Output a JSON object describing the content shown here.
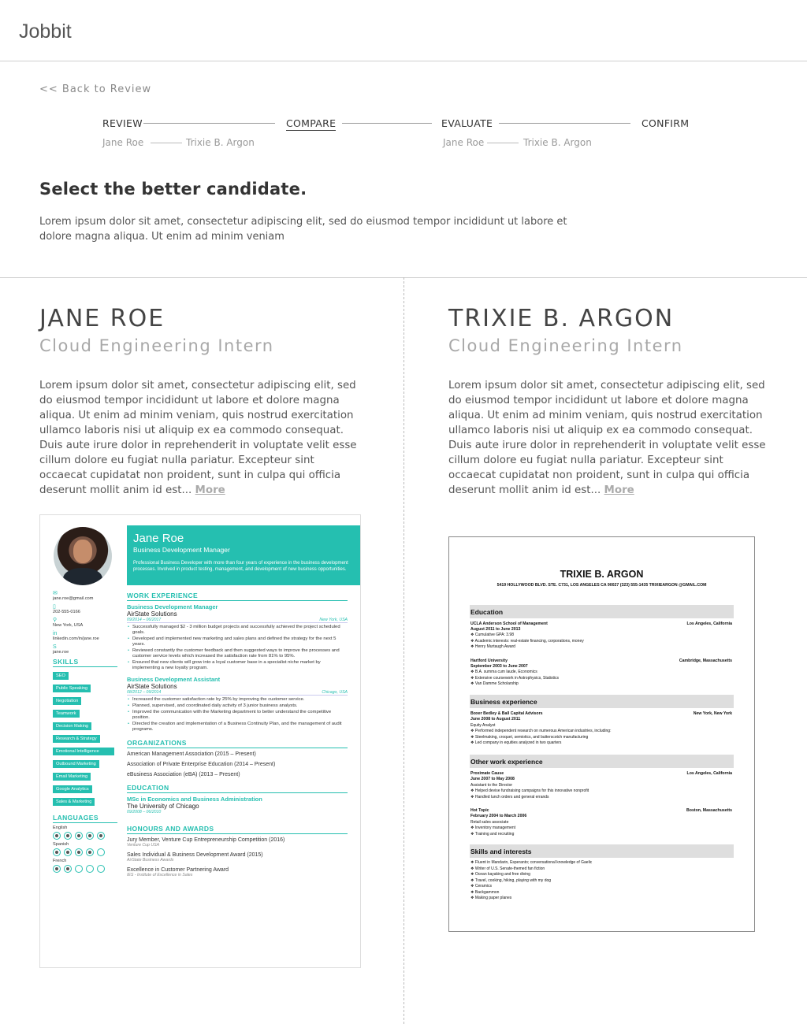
{
  "app": {
    "title": "Jobbit"
  },
  "nav": {
    "back": "<< Back to Review"
  },
  "steps": [
    {
      "label": "REVIEW",
      "names": [
        "Jane Roe",
        "Trixie B. Argon"
      ]
    },
    {
      "label": "COMPARE"
    },
    {
      "label": "EVALUATE",
      "names": [
        "Jane Roe",
        "Trixie B. Argon"
      ]
    },
    {
      "label": "CONFIRM"
    }
  ],
  "heading": "Select the better candidate.",
  "intro": "Lorem ipsum dolor sit amet, consectetur adipiscing elit, sed do eiusmod tempor incididunt ut labore et dolore magna aliqua. Ut enim ad minim veniam",
  "candidates": [
    {
      "name": "JANE ROE",
      "role": "Cloud Engineering Intern",
      "desc": "Lorem ipsum dolor sit amet, consectetur adipiscing elit, sed do eiusmod tempor incididunt ut labore et dolore magna aliqua. Ut enim ad minim veniam, quis nostrud exercitation ullamco laboris nisi ut aliquip ex ea commodo consequat. Duis aute irure dolor in reprehenderit in voluptate velit esse cillum dolore eu fugiat nulla pariatur. Excepteur sint occaecat cupidatat non proident, sunt in culpa qui officia deserunt mollit anim id est...",
      "more": "More"
    },
    {
      "name": "TRIXIE B. ARGON",
      "role": "Cloud Engineering Intern",
      "desc": "Lorem ipsum dolor sit amet, consectetur adipiscing elit, sed do eiusmod tempor incididunt ut labore et dolore magna aliqua. Ut enim ad minim veniam, quis nostrud exercitation ullamco laboris nisi ut aliquip ex ea commodo consequat. Duis aute irure dolor in reprehenderit in voluptate velit esse cillum dolore eu fugiat nulla pariatur. Excepteur sint occaecat cupidatat non proident, sunt in culpa qui officia deserunt mollit anim id est...",
      "more": "More"
    }
  ],
  "resume1": {
    "name": "Jane Roe",
    "title": "Business Development Manager",
    "summary": "Professional Business Developer with more than four years of experience in the business development processes. Involved in product testing, management, and development of new business opportunities.",
    "contact": [
      "jane.roe@gmail.com",
      "202-555-0166",
      "New York, USA",
      "linkedin.com/in/jane.roe",
      "jane.roe"
    ],
    "skills_heading": "SKILLS",
    "skills": [
      "SEO",
      "Public Speaking",
      "Negotiation",
      "Teamwork",
      "Decision Making",
      "Research & Strategy",
      "Emotional Intelligence",
      "Outbound Marketing",
      "Email Marketing",
      "Google Analytics",
      "Sales & Marketing"
    ],
    "languages_heading": "LANGUAGES",
    "languages": [
      {
        "name": "English",
        "level": 5
      },
      {
        "name": "Spanish",
        "level": 4
      },
      {
        "name": "French",
        "level": 2
      }
    ],
    "work_heading": "WORK EXPERIENCE",
    "jobs": [
      {
        "title": "Business Development Manager",
        "company": "AirState Solutions",
        "dates": "09/2014 – 06/2017",
        "place": "New York, USA",
        "bullets": [
          "Successfully managed $2 - 3 million budget projects and successfully achieved the project scheduled goals.",
          "Developed and implemented new marketing and sales plans and defined the strategy for the next 5 years.",
          "Reviewed constantly the customer feedback and then suggested ways to improve the processes and customer service levels which increased the satisfaction rate from 81% to 95%.",
          "Ensured that new clients will grow into a loyal customer base in a specialist niche market by implementing a new loyalty program."
        ]
      },
      {
        "title": "Business Development Assistant",
        "company": "AirState Solutions",
        "dates": "08/2012 – 09/2014",
        "place": "Chicago, USA",
        "bullets": [
          "Increased the customer satisfaction rate by 25% by improving the customer service.",
          "Planned, supervised, and coordinated daily activity of 3 junior business analysts.",
          "Improved the communication with the Marketing department to better understand the competitive position.",
          "Directed the creation and implementation of a Business Continuity Plan, and the management of audit programs."
        ]
      }
    ],
    "org_heading": "ORGANIZATIONS",
    "orgs": [
      "American Management Association (2015 – Present)",
      "Association of Private Enterprise Education (2014 – Present)",
      "eBusiness Association (eBA) (2013 – Present)"
    ],
    "edu_heading": "EDUCATION",
    "edu": {
      "degree": "MSc in Economics and Business Administration",
      "school": "The University of Chicago",
      "dates": "09/2008 – 06/2010"
    },
    "awards_heading": "HONOURS AND AWARDS",
    "awards": [
      {
        "name": "Jury Member, Venture Cup Entrepreneurship Competition (2016)",
        "org": "Venture Cup USA"
      },
      {
        "name": "Sales Individual & Business Development Award (2015)",
        "org": "AirState Business Awards"
      },
      {
        "name": "Excellence in Customer Partnering Award",
        "org": "IES - Institute of Excellence in Sales"
      }
    ]
  },
  "resume2": {
    "name": "TRIXIE B. ARGON",
    "address": "5419 HOLLYWOOD BLVD. STE. C731, LOS ANGELES CA 90027   (323) 555-1435   TRIXIEARGON @GMAIL.COM",
    "sections": {
      "education": "Education",
      "business": "Business experience",
      "other": "Other work experience",
      "skills": "Skills and interests"
    },
    "edu1": {
      "school": "UCLA Anderson School of Management",
      "place": "Los Angeles, California",
      "dates": "August 2011 to June 2013",
      "bullets": [
        "Cumulative GPA: 3.98",
        "Academic interests: real-estate financing, corporations, money",
        "Henry Murtaugh Award"
      ]
    },
    "edu2": {
      "school": "Hartford University",
      "place": "Cambridge, Massachusetts",
      "dates": "September 2003 to June 2007",
      "bullets": [
        "B.A. summa cum laude, Economics",
        "Extensive coursework in Astrophysics, Statistics",
        "Van Damme Scholarship"
      ]
    },
    "biz1": {
      "company": "Boxer Bedley & Ball Capital Advisors",
      "place": "New York, New York",
      "dates": "June 2008 to August 2011",
      "role": "Equity Analyst",
      "bullets": [
        "Performed independent research on numerous American industries, including:",
        "Steelmaking, croquet, semiotics, and butterscotch manufacturing",
        "Led company in equities analyzed in two quarters"
      ]
    },
    "oth1": {
      "company": "Proximate Cause",
      "place": "Los Angeles, California",
      "dates": "June 2007 to May 2008",
      "role": "Assistant to the Director",
      "bullets": [
        "Helped devise fundraising campaigns for this innovative nonprofit",
        "Handled lunch orders and general errands"
      ]
    },
    "oth2": {
      "company": "Hot Topic",
      "place": "Boston, Massachusetts",
      "dates": "February 2004 to March 2006",
      "role": "Retail sales associate",
      "bullets": [
        "Inventory management",
        "Training and recruiting"
      ]
    },
    "interests": [
      "Fluent in Mandarin, Esperanto; conversational knowledge of Gaelic",
      "Writer of U.S. Senate-themed fan fiction",
      "Ocean kayaking and free diving",
      "Travel, cooking, hiking, playing with my dog",
      "Ceramics",
      "Backgammon",
      "Making paper planes"
    ]
  }
}
